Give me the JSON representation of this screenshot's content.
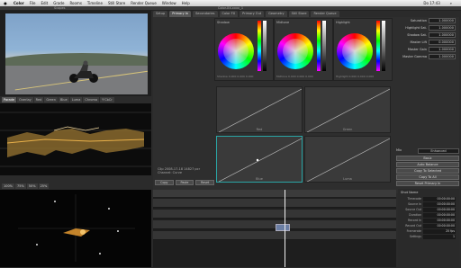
{
  "menubar": {
    "app": "Color",
    "items": [
      "File",
      "Edit",
      "Grade",
      "Rooms",
      "Timeline",
      "Still Store",
      "Render Queue",
      "Window",
      "Help"
    ],
    "clock": "Do 17:43"
  },
  "title": "Color-XX-xxxx_1",
  "left_title": "Scopes",
  "scope_tabs": [
    "Parade",
    "Overlay",
    "Red",
    "Green",
    "Blue",
    "Luma",
    "Chroma",
    "Y'CbCr"
  ],
  "vectorscope_tabs": [
    "100%",
    "75%",
    "50%",
    "25%"
  ],
  "top_tabs": [
    "Setup",
    "Primary In",
    "Secondaries",
    "Color FX",
    "Primary Out",
    "Geometry",
    "Still Store",
    "Render Queue"
  ],
  "wheels": [
    {
      "label": "Shadow",
      "stats": "Shadow 0.000 0.000 0.000"
    },
    {
      "label": "Midtone",
      "stats": "Midtone 0.000 0.000 0.000"
    },
    {
      "label": "Highlight",
      "stats": "Highlight 0.000 0.000 0.000"
    }
  ],
  "params": [
    {
      "label": "Saturation",
      "value": "1.000000"
    },
    {
      "label": "Highlight Sat.",
      "value": "1.000000"
    },
    {
      "label": "Shadow Sat.",
      "value": "1.000000"
    },
    {
      "label": "Master Lift",
      "value": "0.000000"
    },
    {
      "label": "Master Gain",
      "value": "1.000000"
    },
    {
      "label": "Master Gamma",
      "value": "1.000000"
    }
  ],
  "curves": [
    "Red",
    "Green",
    "Blue",
    "Luma"
  ],
  "clip_info": {
    "line1": "Clip 2008-17-18 14827 pcr",
    "line2": "Channel: Curve"
  },
  "mid_buttons": [
    "Copy",
    "Paste",
    "Reset"
  ],
  "side_buttons": [
    "Basic",
    "Auto Balance",
    "Copy To Selected",
    "Copy To All",
    "Reset Primary In"
  ],
  "side_header": {
    "label": "Mix",
    "value": "Enhanced"
  },
  "timeline": {
    "info_title": "Shot Name",
    "rows": [
      {
        "label": "Timecode",
        "value": "00:00:00:00"
      },
      {
        "label": "Source In",
        "value": "00:00:00:00"
      },
      {
        "label": "Source Out",
        "value": "00:00:00:00"
      },
      {
        "label": "Duration",
        "value": "00:00:00:00"
      },
      {
        "label": "Record In",
        "value": "00:00:00:00"
      },
      {
        "label": "Record Out",
        "value": "00:00:00:00"
      },
      {
        "label": "Framerate",
        "value": "25 fps"
      },
      {
        "label": "Settings",
        "value": "1"
      }
    ]
  },
  "colors": {
    "accent": "#2aa5a5",
    "playhead": "#f0f0f0"
  }
}
